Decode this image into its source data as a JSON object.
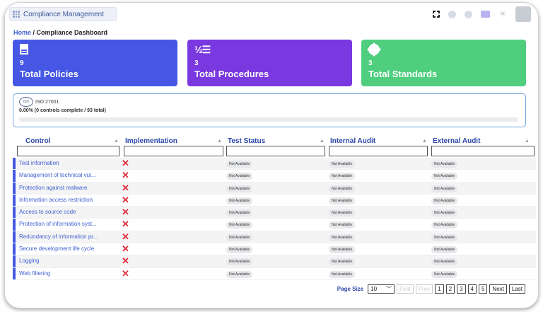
{
  "app": {
    "tab_label": "Compliance Management"
  },
  "topbar": {
    "icons": [
      "fullscreen-icon",
      "eye-icon",
      "notification-icon",
      "chat-icon",
      "theme-icon",
      "avatar"
    ]
  },
  "breadcrumb": {
    "home": "Home",
    "separator": " / ",
    "current": "Compliance Dashboard"
  },
  "cards": [
    {
      "count": "9",
      "label": "Total Policies",
      "icon": "document-icon",
      "color": "#4657e5"
    },
    {
      "count": "3",
      "label": "Total Procedures",
      "icon": "ordered-list-icon",
      "color": "#7a38e0"
    },
    {
      "count": "3",
      "label": "Total Standards",
      "icon": "certificate-icon",
      "color": "#4fce7e"
    }
  ],
  "iso": {
    "name": "ISO 27001",
    "progress_text": "0.00% (0 controls complete / 93 total)",
    "progress": 0
  },
  "table": {
    "columns": [
      "Control",
      "Implementation",
      "Test Status",
      "Internal Audit",
      "External Audit"
    ],
    "rows": [
      {
        "control": "Test information",
        "test": "Not Available",
        "internal": "Not Available",
        "external": "Not Available"
      },
      {
        "control": "Management of technical vul...",
        "test": "Not Available",
        "internal": "Not Available",
        "external": "Not Available"
      },
      {
        "control": "Protection against malware",
        "test": "Not Available",
        "internal": "Not Available",
        "external": "Not Available"
      },
      {
        "control": "Information access restriction",
        "test": "Not Available",
        "internal": "Not Available",
        "external": "Not Available"
      },
      {
        "control": "Access to source code",
        "test": "Not Available",
        "internal": "Not Available",
        "external": "Not Available"
      },
      {
        "control": "Protection of information syst...",
        "test": "Not Available",
        "internal": "Not Available",
        "external": "Not Available"
      },
      {
        "control": "Redundancy of information pr...",
        "test": "Not Available",
        "internal": "Not Available",
        "external": "Not Available"
      },
      {
        "control": "Secure development life cycle",
        "test": "Not Available",
        "internal": "Not Available",
        "external": "Not Available"
      },
      {
        "control": "Logging",
        "test": "Not Available",
        "internal": "Not Available",
        "external": "Not Available"
      },
      {
        "control": "Web filtering",
        "test": "Not Available",
        "internal": "Not Available",
        "external": "Not Available"
      }
    ],
    "implementation_mark": "✕"
  },
  "pager": {
    "page_size_label": "Page Size",
    "page_size": "10",
    "first": "First",
    "prev": "Prev",
    "pages": [
      "1",
      "2",
      "3",
      "4",
      "5"
    ],
    "next": "Next",
    "last": "Last"
  }
}
